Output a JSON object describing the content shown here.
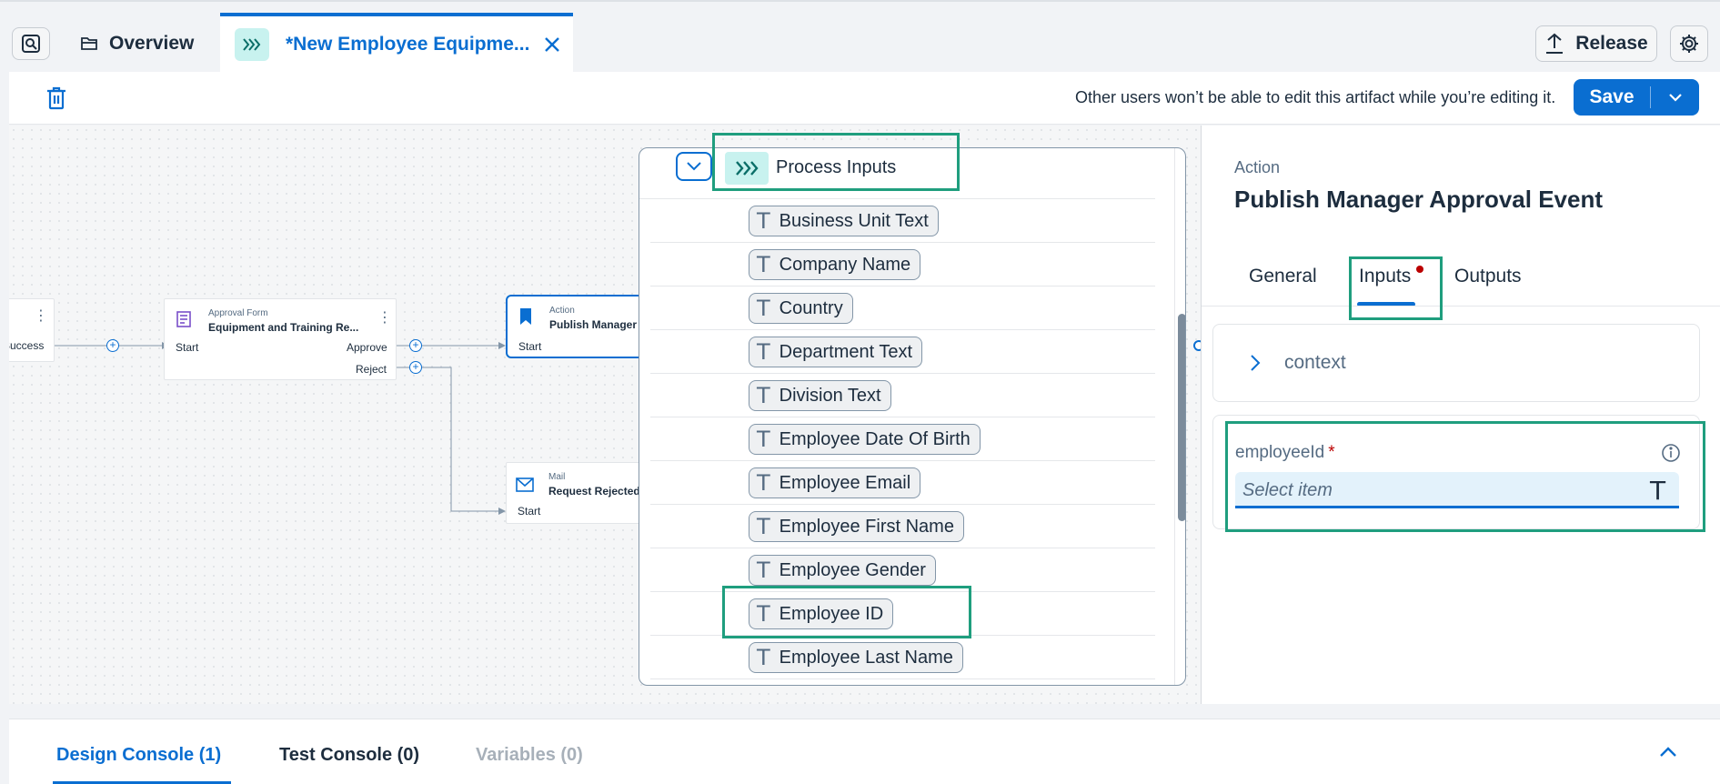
{
  "topbar": {
    "overview_label": "Overview",
    "active_tab_title": "*New Employee Equipme...",
    "release_label": "Release"
  },
  "toolbar": {
    "edit_notice": "Other users won’t be able to edit this artifact while you’re editing it.",
    "save_label": "Save"
  },
  "canvas": {
    "nodes": {
      "partial_success_port": "Success",
      "approval": {
        "type": "Approval Form",
        "name": "Equipment and Training Re...",
        "start": "Start",
        "approve": "Approve",
        "reject": "Reject"
      },
      "action": {
        "type": "Action",
        "name": "Publish Manager A",
        "start": "Start"
      },
      "mail": {
        "type": "Mail",
        "name": "Request Rejected",
        "start": "Start"
      }
    }
  },
  "dropdown": {
    "header": "Process Inputs",
    "type_glyph": "T",
    "items": [
      "Business Unit Text",
      "Company Name",
      "Country",
      "Department Text",
      "Division Text",
      "Employee Date Of Birth",
      "Employee Email",
      "Employee First Name",
      "Employee Gender",
      "Employee ID",
      "Employee Last Name"
    ]
  },
  "panel": {
    "type_label": "Action",
    "title": "Publish Manager Approval Event",
    "tabs": [
      "General",
      "Inputs",
      "Outputs"
    ],
    "active_tab": "Inputs",
    "context_label": "context",
    "field": {
      "label": "employeeId",
      "required_mark": "*",
      "placeholder": "Select item",
      "type_glyph": "T"
    }
  },
  "console": {
    "tabs": [
      "Design Console (1)",
      "Test Console (0)",
      "Variables (0)"
    ]
  },
  "colors": {
    "accent": "#0a6ed1",
    "highlight": "#1f9e7e",
    "process_badge": "#c8f2ef",
    "required": "#bb0000"
  }
}
